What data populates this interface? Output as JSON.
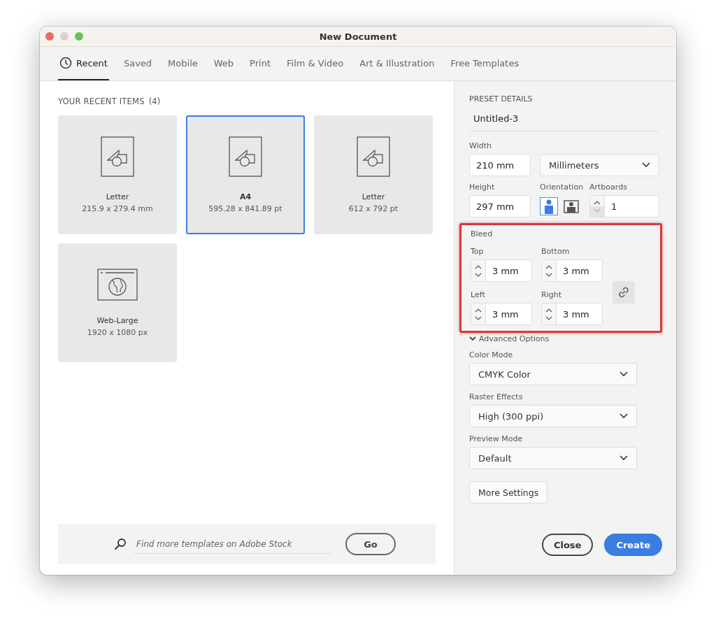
{
  "window": {
    "title": "New Document"
  },
  "tabs": [
    {
      "label": "Recent",
      "selected": true
    },
    {
      "label": "Saved",
      "selected": false
    },
    {
      "label": "Mobile",
      "selected": false
    },
    {
      "label": "Web",
      "selected": false
    },
    {
      "label": "Print",
      "selected": false
    },
    {
      "label": "Film & Video",
      "selected": false
    },
    {
      "label": "Art & Illustration",
      "selected": false
    },
    {
      "label": "Free Templates",
      "selected": false
    }
  ],
  "recent": {
    "heading": "YOUR RECENT ITEMS",
    "count": "(4)",
    "items": [
      {
        "kind": "print",
        "name": "Letter",
        "size": "215.9 x 279.4 mm",
        "selected": false
      },
      {
        "kind": "print",
        "name": "A4",
        "size": "595.28 x 841.89 pt",
        "selected": true
      },
      {
        "kind": "print",
        "name": "Letter",
        "size": "612 x 792 pt",
        "selected": false
      },
      {
        "kind": "web",
        "name": "Web-Large",
        "size": "1920 x 1080 px",
        "selected": false
      }
    ]
  },
  "search": {
    "placeholder": "Find more templates on Adobe Stock",
    "button": "Go"
  },
  "preset": {
    "heading": "PRESET DETAILS",
    "name": "Untitled-3",
    "width_label": "Width",
    "width": "210 mm",
    "units": "Millimeters",
    "height_label": "Height",
    "height": "297 mm",
    "orientation_label": "Orientation",
    "orientations": [
      {
        "kind": "portrait",
        "selected": true
      },
      {
        "kind": "landscape",
        "selected": false
      }
    ],
    "artboards_label": "Artboards",
    "artboards": "1",
    "artboards_decrement_disabled": true,
    "bleed": {
      "highlighted": true,
      "label": "Bleed",
      "fields": [
        {
          "label": "Top",
          "value": "3 mm"
        },
        {
          "label": "Bottom",
          "value": "3 mm"
        },
        {
          "label": "Left",
          "value": "3 mm"
        },
        {
          "label": "Right",
          "value": "3 mm"
        }
      ],
      "linked": true
    },
    "advanced": {
      "label": "Advanced Options",
      "expanded": true,
      "selects": [
        {
          "label": "Color Mode",
          "value": "CMYK Color"
        },
        {
          "label": "Raster Effects",
          "value": "High (300 ppi)"
        },
        {
          "label": "Preview Mode",
          "value": "Default"
        }
      ]
    },
    "more_settings": "More Settings"
  },
  "buttons": [
    {
      "kind": "secondary",
      "label": "Close"
    },
    {
      "kind": "primary",
      "label": "Create"
    }
  ]
}
